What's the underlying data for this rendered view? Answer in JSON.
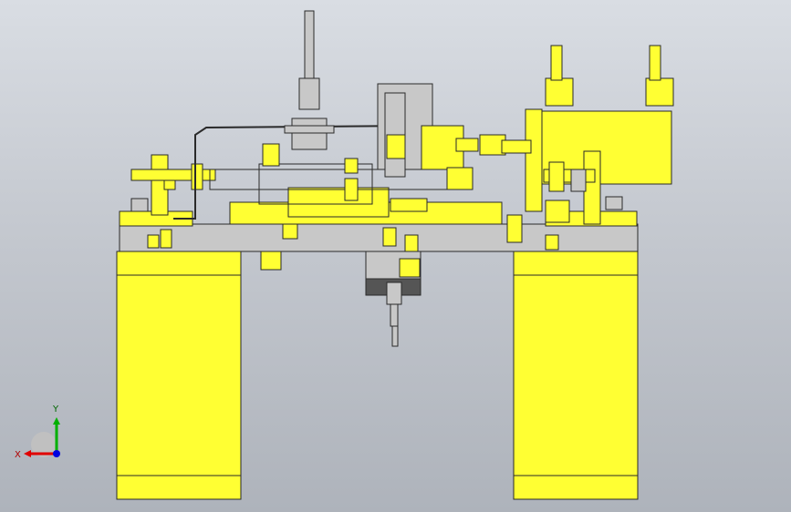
{
  "viewport": {
    "background_top": "#d9dde3",
    "background_bottom": "#aeb3bb"
  },
  "colors": {
    "yellow": "#ffff33",
    "yellow_shade": "#e6e600",
    "gray_part": "#c8c8c8",
    "dark_gray": "#555555",
    "outline": "#2a2a2a",
    "x_axis": "#e00000",
    "y_axis": "#00b000",
    "z_axis": "#0000e0"
  },
  "triad": {
    "x_label": "X",
    "y_label": "Y"
  }
}
